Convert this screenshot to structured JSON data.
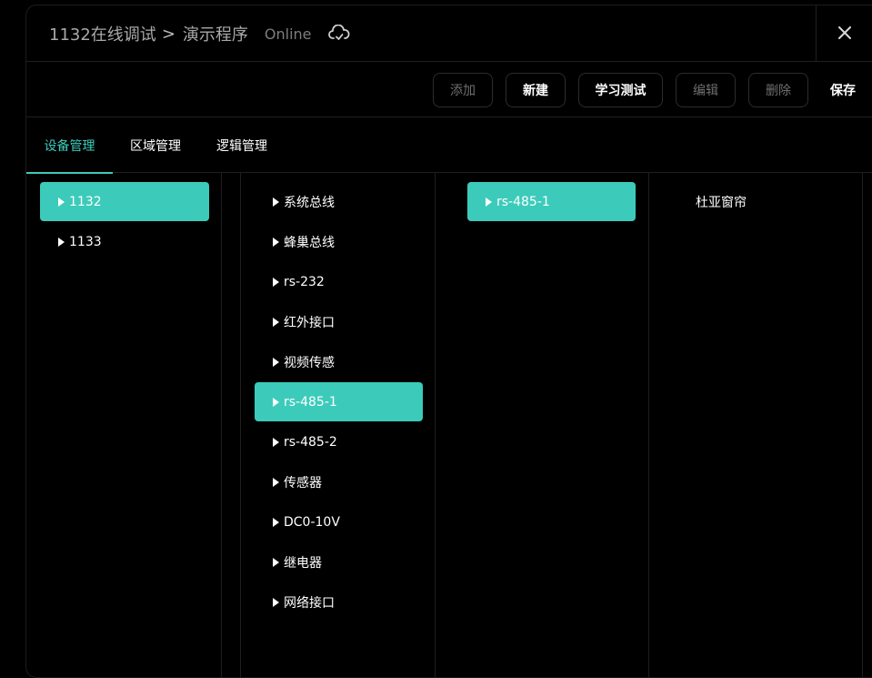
{
  "header": {
    "breadcrumb": [
      "1132在线调试",
      "演示程序"
    ],
    "separator": ">",
    "status": "Online",
    "cloud_icon": "cloud-sync-icon",
    "close_icon": "close-icon"
  },
  "toolbar": {
    "add_label": "添加",
    "new_label": "新建",
    "learn_test_label": "学习测试",
    "edit_label": "编辑",
    "delete_label": "删除",
    "save_label": "保存"
  },
  "tabs": [
    {
      "label": "设备管理",
      "active": true
    },
    {
      "label": "区域管理",
      "active": false
    },
    {
      "label": "逻辑管理",
      "active": false
    }
  ],
  "columns": {
    "devices": [
      {
        "label": "1132",
        "selected": true
      },
      {
        "label": "1133",
        "selected": false
      }
    ],
    "interfaces": [
      {
        "label": "系统总线",
        "selected": false
      },
      {
        "label": "蜂巢总线",
        "selected": false
      },
      {
        "label": "rs-232",
        "selected": false
      },
      {
        "label": "红外接口",
        "selected": false
      },
      {
        "label": "视频传感",
        "selected": false
      },
      {
        "label": "rs-485-1",
        "selected": true
      },
      {
        "label": "rs-485-2",
        "selected": false
      },
      {
        "label": "传感器",
        "selected": false
      },
      {
        "label": "DC0-10V",
        "selected": false
      },
      {
        "label": "继电器",
        "selected": false
      },
      {
        "label": "网络接口",
        "selected": false
      }
    ],
    "ports": [
      {
        "label": "rs-485-1",
        "selected": true
      }
    ],
    "endpoints": [
      {
        "label": "杜亚窗帘"
      }
    ]
  },
  "colors": {
    "accent": "#3ccbba",
    "background": "#000000",
    "muted_text": "#a9a9a9",
    "disabled_text": "#6f6f6f"
  }
}
